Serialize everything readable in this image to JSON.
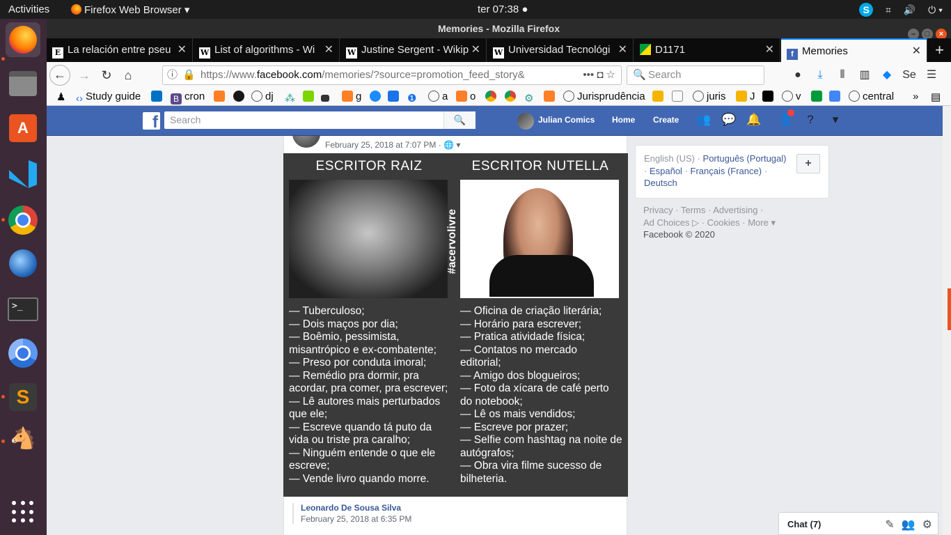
{
  "topbar": {
    "activities": "Activities",
    "app_menu": "Firefox Web Browser",
    "clock": "ter 07:38",
    "skype_label": "S"
  },
  "dock": {
    "items": [
      "firefox-icon",
      "files-icon",
      "software-store-icon",
      "vscode-icon",
      "chrome-icon",
      "thunderbird-icon",
      "terminal-icon",
      "chromium-icon",
      "sublime-text-icon",
      "emule-icon",
      "show-apps-icon"
    ]
  },
  "window": {
    "title": "Memories - Mozilla Firefox"
  },
  "tabs": [
    {
      "label": "La relación entre pseu",
      "favicon": "E"
    },
    {
      "label": "List of algorithms - Wi",
      "favicon": "W"
    },
    {
      "label": "Justine Sergent - Wikip",
      "favicon": "W"
    },
    {
      "label": "Universidad Tecnológi",
      "favicon": "W"
    },
    {
      "label": "D1171",
      "favicon": ""
    },
    {
      "label": "Memories",
      "favicon": "f"
    }
  ],
  "navbar": {
    "url_prefix": "https://www.",
    "url_domain": "facebook.com",
    "url_path": "/memories/?source=promotion_feed_story&",
    "search_placeholder": "Search"
  },
  "bookmarks": [
    "Study guide",
    "cron",
    "dj",
    "g",
    "a",
    "o",
    "Jurisprudência",
    "juris",
    "J",
    "v",
    "central"
  ],
  "facebook": {
    "search_placeholder": "Search",
    "user_name": "Julian Comics",
    "nav_home": "Home",
    "nav_create": "Create",
    "post": {
      "date": "February 25, 2018 at 7:07 PM · ",
      "meme": {
        "left_title": "ESCRITOR RAIZ",
        "right_title": "ESCRITOR NUTELLA",
        "hashtag": "#acervolivre",
        "left_items": [
          "— Tuberculoso;",
          "— Dois maços por dia;",
          "— Boêmio, pessimista,",
          "misantrópico e ex-combatente;",
          "— Preso por conduta imoral;",
          "— Remédio pra dormir, pra",
          "acordar, pra comer, pra escrever;",
          "— Lê autores mais perturbados",
          "que ele;",
          "— Escreve quando tá puto da",
          "vida ou triste pra caralho;",
          "— Ninguém entende o que ele",
          "escreve;",
          "— Vende livro quando morre."
        ],
        "right_items": [
          "— Oficina de criação literária;",
          "— Horário para escrever;",
          "— Pratica atividade física;",
          "— Contatos no mercado",
          "editorial;",
          "— Amigo dos blogueiros;",
          "— Foto da xícara de café perto",
          "do notebook;",
          "— Lê os mais vendidos;",
          "— Escreve por prazer;",
          "— Selfie com hashtag na noite de",
          "autógrafos;",
          "— Obra vira filme sucesso de",
          "bilheteria."
        ]
      },
      "comment": {
        "author": "Leonardo De Sousa Silva",
        "date": "February 25, 2018 at 6:35 PM"
      }
    },
    "languages": {
      "current": "English (US)",
      "portuguese": "Português (Portugal)",
      "spanish": "Español",
      "french": "Français (France)",
      "german": "Deutsch"
    },
    "footer": {
      "privacy": "Privacy",
      "terms": "Terms",
      "advertising": "Advertising",
      "ad_choices": "Ad Choices",
      "cookies": "Cookies",
      "more": "More",
      "copyright": "Facebook © 2020"
    },
    "chat": {
      "label": "Chat (7)"
    }
  }
}
